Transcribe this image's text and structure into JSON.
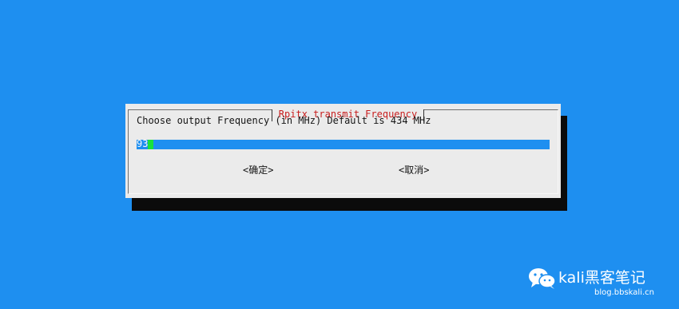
{
  "dialog": {
    "title": "Rpitx transmit Frequency",
    "prompt": "Choose output Frequency (in MHz) Default is 434 MHz",
    "input_value": "93",
    "ok_label": "<确定>",
    "cancel_label": "<取消>"
  },
  "watermark": {
    "brand": "kali黑客笔记",
    "url": "blog.bbskali.cn"
  },
  "colors": {
    "background": "#1e8ff0",
    "dialog_bg": "#ebebeb",
    "title_text": "#c81e1e",
    "cursor": "#19e13c"
  }
}
